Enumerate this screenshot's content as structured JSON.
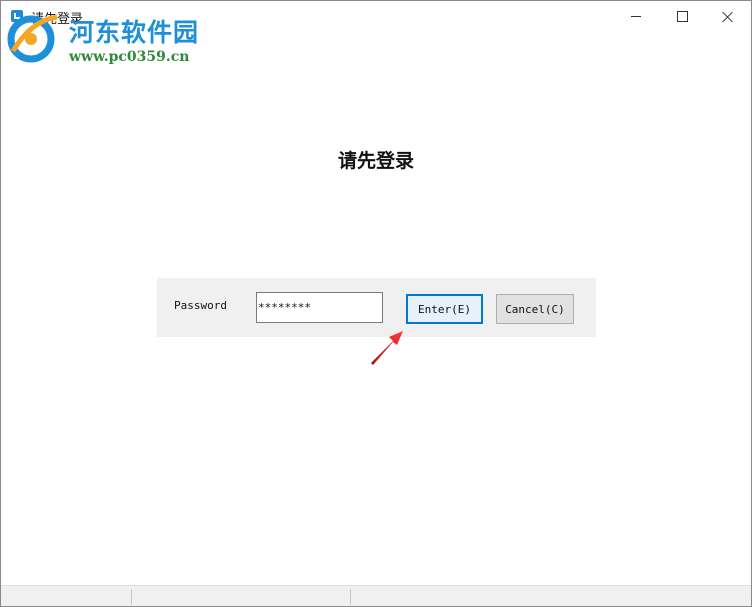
{
  "window": {
    "title": "请先登录",
    "controls": {
      "minimize": "minimize-icon",
      "maximize": "maximize-icon",
      "close": "close-icon"
    }
  },
  "watermark": {
    "name": "河东软件园",
    "url": "www.pc0359.cn"
  },
  "heading": "请先登录",
  "login_form": {
    "password_label": "Password",
    "password_value": "********",
    "enter_label": "Enter(E)",
    "cancel_label": "Cancel(C)"
  },
  "colors": {
    "accent": "#0078d7",
    "panel_bg": "#f0f0f0",
    "annotation_arrow": "#d11a1a",
    "watermark_blue": "#1e8fd9",
    "watermark_green": "#2e8b3a"
  }
}
